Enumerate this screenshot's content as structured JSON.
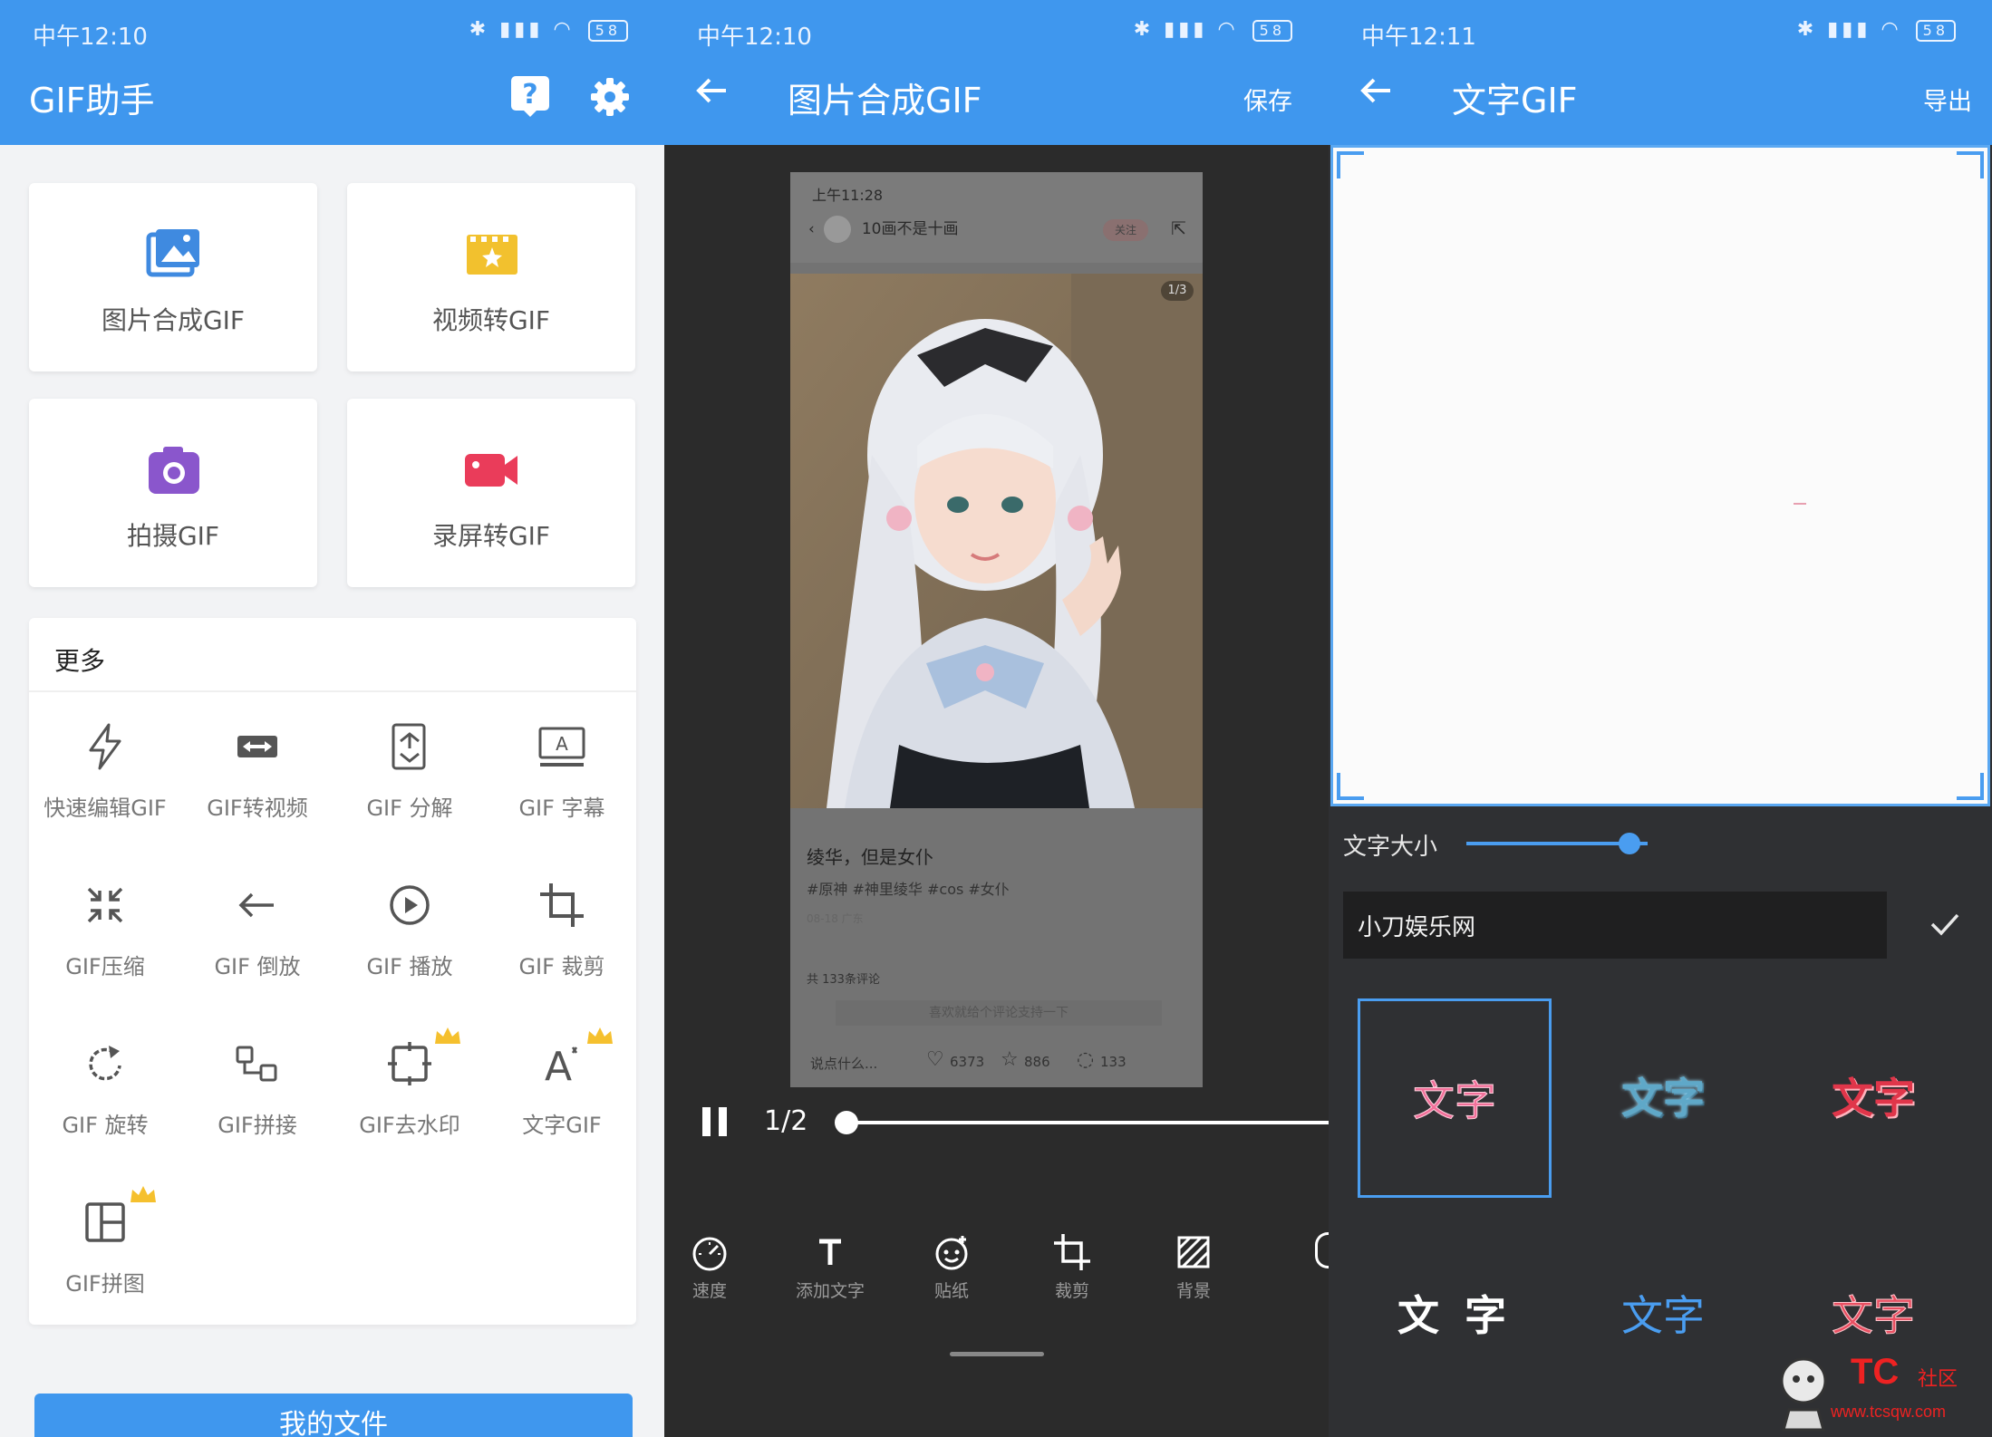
{
  "colors": {
    "accent": "#3f97ee",
    "dark_bg": "#2b2b2b",
    "panel3_bg": "#2f3033"
  },
  "panel1": {
    "status": {
      "time": "中午12:10",
      "battery": "58"
    },
    "title": "GIF助手",
    "icons": [
      "help-icon",
      "gear-icon"
    ],
    "cards": [
      {
        "label": "图片合成GIF",
        "icon": "image-icon",
        "color": "#3f8ae0"
      },
      {
        "label": "视频转GIF",
        "icon": "clapperboard-icon",
        "color": "#f2c12e"
      },
      {
        "label": "拍摄GIF",
        "icon": "camera-icon",
        "color": "#8a56cc"
      },
      {
        "label": "录屏转GIF",
        "icon": "video-camera-icon",
        "color": "#ea3c5a"
      }
    ],
    "more": {
      "heading": "更多",
      "tools": [
        {
          "label": "快速编辑GIF",
          "icon": "lightning-icon"
        },
        {
          "label": "GIF转视频",
          "icon": "video-convert-icon"
        },
        {
          "label": "GIF 分解",
          "icon": "split-icon"
        },
        {
          "label": "GIF 字幕",
          "icon": "subtitle-icon"
        },
        {
          "label": "GIF压缩",
          "icon": "compress-icon"
        },
        {
          "label": "GIF 倒放",
          "icon": "reverse-arrow-icon"
        },
        {
          "label": "GIF 播放",
          "icon": "play-circle-icon"
        },
        {
          "label": "GIF 裁剪",
          "icon": "crop-icon"
        },
        {
          "label": "GIF 旋转",
          "icon": "rotate-icon"
        },
        {
          "label": "GIF拼接",
          "icon": "join-icon"
        },
        {
          "label": "GIF去水印",
          "icon": "remove-watermark-icon",
          "premium": true
        },
        {
          "label": "文字GIF",
          "icon": "text-icon",
          "premium": true
        },
        {
          "label": "GIF拼图",
          "icon": "collage-icon",
          "premium": true
        }
      ]
    },
    "my_files": "我的文件"
  },
  "panel2": {
    "status": {
      "time": "中午12:10",
      "battery": "58"
    },
    "title": "图片合成GIF",
    "save": "保存",
    "preview": {
      "time": "上午11:28",
      "author": "10画不是十画",
      "follow": "关注",
      "pager": "1/3",
      "post_title": "绫华，但是女仆",
      "tags": "#原神 #神里绫华 #cos #女仆",
      "date": "08-18 广东",
      "comments": "共 133条评论",
      "hint": "喜欢就给个评论支持一下",
      "input": "说点什么...",
      "likes": "6373",
      "stars": "886",
      "comment_count": "133"
    },
    "playback": {
      "page": "1/2",
      "progress": 0
    },
    "toolbar": [
      {
        "label": "速度",
        "icon": "speedometer-icon"
      },
      {
        "label": "添加文字",
        "icon": "text-t-icon"
      },
      {
        "label": "贴纸",
        "icon": "sticker-icon"
      },
      {
        "label": "裁剪",
        "icon": "crop-icon"
      },
      {
        "label": "背景",
        "icon": "background-icon"
      }
    ]
  },
  "panel3": {
    "status": {
      "time": "中午12:11",
      "battery": "58"
    },
    "title": "文字GIF",
    "export": "导出",
    "size_label": "文字大小",
    "size_value": 0.9,
    "input_value": "小刀娱乐网",
    "styles": [
      {
        "text": "文字",
        "style": "pink-outline",
        "selected": true
      },
      {
        "text": "文字",
        "style": "cyan-bold"
      },
      {
        "text": "文字",
        "style": "red-bold"
      },
      {
        "text": "文 字",
        "style": "white-bold"
      },
      {
        "text": "文字",
        "style": "blue-plain"
      },
      {
        "text": "文字",
        "style": "red-outline"
      }
    ]
  },
  "watermark": {
    "logo": "TC",
    "text": "社区",
    "url": "www.tcsqw.com"
  }
}
